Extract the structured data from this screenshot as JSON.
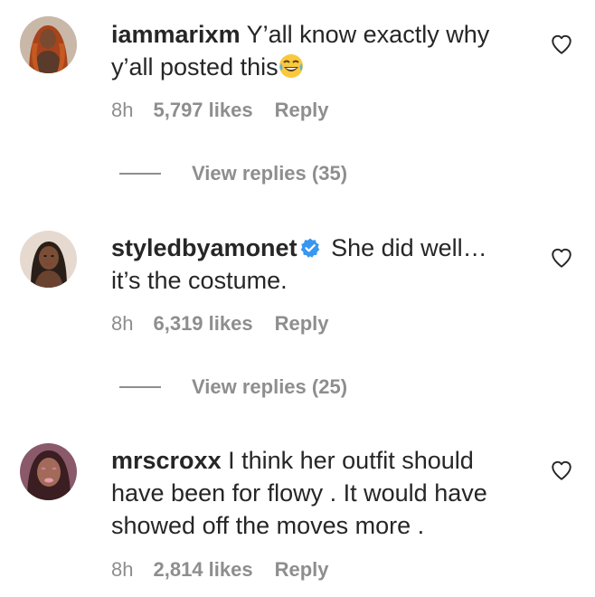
{
  "comments": [
    {
      "username": "iammarixm",
      "verified": false,
      "text_line1": "Y’all know exactly why",
      "text_line2": "y’all posted this",
      "emoji": "face-with-tears-of-joy",
      "time": "8h",
      "likes": "5,797 likes",
      "reply": "Reply",
      "view_replies": "View replies (35)"
    },
    {
      "username": "styledbyamonet",
      "verified": true,
      "text_line1": "She did well…",
      "text_line2": "it’s the costume.",
      "time": "8h",
      "likes": "6,319 likes",
      "reply": "Reply",
      "view_replies": "View replies (25)"
    },
    {
      "username": "mrscroxx",
      "verified": false,
      "text_line1": "I think her outfit should",
      "text_line2": "have been for flowy . It would have",
      "text_line3": "showed off the moves more .",
      "time": "8h",
      "likes": "2,814 likes",
      "reply": "Reply"
    }
  ],
  "colors": {
    "text": "#262626",
    "secondary": "#8e8e8e",
    "verified_blue": "#3897f0"
  },
  "icons": {
    "like": "heart-outline-icon",
    "verified": "verified-badge-icon"
  }
}
